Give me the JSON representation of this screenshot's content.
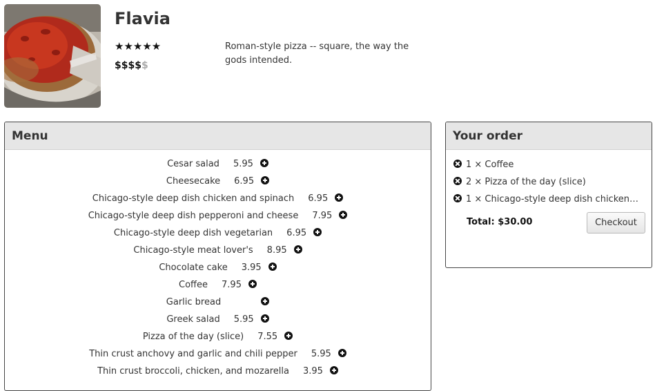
{
  "restaurant": {
    "name": "Flavia",
    "rating_stars": "★★★★★",
    "price_active": "$$$$",
    "price_inactive": "$",
    "description": "Roman-style pizza -- square, the way the gods intended."
  },
  "menu": {
    "heading": "Menu",
    "items": [
      {
        "name": "Cesar salad",
        "price": "5.95"
      },
      {
        "name": "Cheesecake",
        "price": "6.95"
      },
      {
        "name": "Chicago-style deep dish chicken and spinach",
        "price": "6.95"
      },
      {
        "name": "Chicago-style deep dish pepperoni and cheese",
        "price": "7.95"
      },
      {
        "name": "Chicago-style deep dish vegetarian",
        "price": "6.95"
      },
      {
        "name": "Chicago-style meat lover's",
        "price": "8.95"
      },
      {
        "name": "Chocolate cake",
        "price": "3.95"
      },
      {
        "name": "Coffee",
        "price": "7.95"
      },
      {
        "name": "Garlic bread",
        "price": ""
      },
      {
        "name": "Greek salad",
        "price": "5.95"
      },
      {
        "name": "Pizza of the day (slice)",
        "price": "7.55"
      },
      {
        "name": "Thin crust anchovy and garlic and chili pepper",
        "price": "5.95"
      },
      {
        "name": "Thin crust broccoli, chicken, and mozarella",
        "price": "3.95"
      }
    ]
  },
  "order": {
    "heading": "Your order",
    "items": [
      {
        "text": "1 × Coffee"
      },
      {
        "text": "2 × Pizza of the day (slice)"
      },
      {
        "text": "1 × Chicago-style deep dish chicken an..."
      }
    ],
    "total": "Total: $30.00",
    "checkout_label": "Checkout"
  },
  "icons": {
    "add": "plus-circle-icon",
    "remove": "x-circle-icon"
  }
}
